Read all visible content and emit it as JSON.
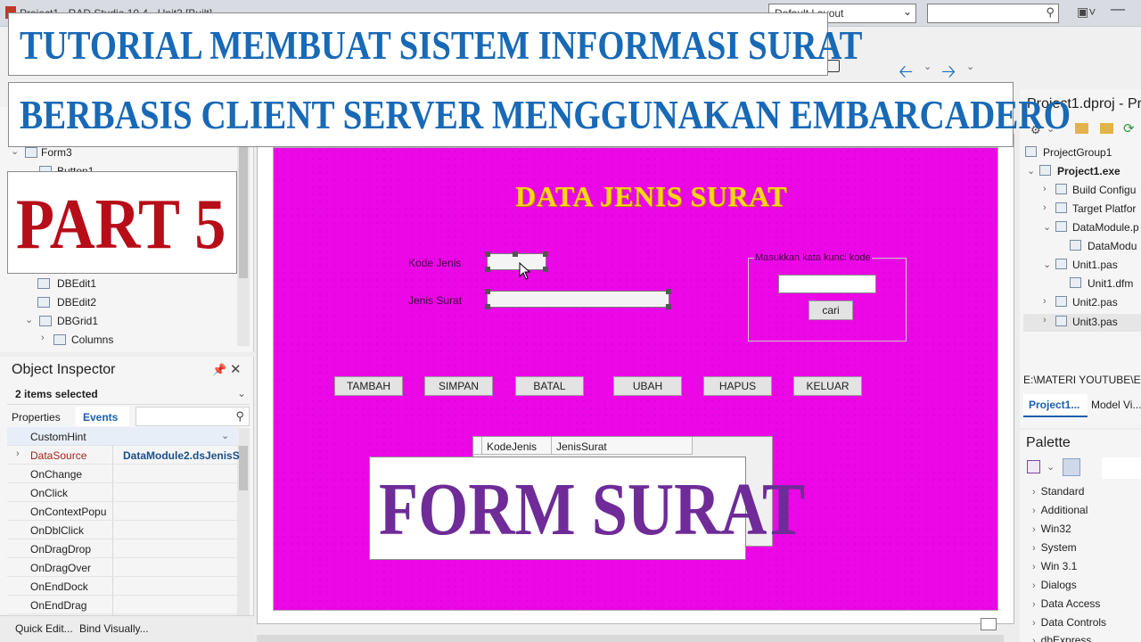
{
  "window": {
    "title": "Project1 - RAD Studio 10.4 - Unit3 [Built]",
    "layout_combo": "Default Layout",
    "search_placeholder": ""
  },
  "banners": {
    "title_line1": "TUTORIAL MEMBUAT SISTEM INFORMASI SURAT",
    "title_line2": "BERBASIS CLIENT SERVER MENGGUNAKAN EMBARCADERO",
    "part": "PART 5",
    "form_title": "FORM SURAT"
  },
  "structure": {
    "items": [
      {
        "label": "Form3",
        "icon": "form-icon"
      },
      {
        "label": "Button1",
        "icon": "button-icon"
      },
      {
        "label": "DBEdit1",
        "icon": "dbedit-icon"
      },
      {
        "label": "DBEdit2",
        "icon": "dbedit-icon"
      },
      {
        "label": "DBGrid1",
        "icon": "dbgrid-icon"
      },
      {
        "label": "Columns",
        "icon": "columns-icon"
      }
    ]
  },
  "object_inspector": {
    "title": "Object Inspector",
    "selection": "2 items selected",
    "tab_properties": "Properties",
    "tab_events": "Events",
    "rows": [
      {
        "name": "CustomHint",
        "value": ""
      },
      {
        "name": "DataSource",
        "value": "DataModule2.dsJenisS"
      },
      {
        "name": "OnChange",
        "value": ""
      },
      {
        "name": "OnClick",
        "value": ""
      },
      {
        "name": "OnContextPopu",
        "value": ""
      },
      {
        "name": "OnDblClick",
        "value": ""
      },
      {
        "name": "OnDragDrop",
        "value": ""
      },
      {
        "name": "OnDragOver",
        "value": ""
      },
      {
        "name": "OnEndDock",
        "value": ""
      },
      {
        "name": "OnEndDrag",
        "value": ""
      }
    ],
    "quick_edit": "Quick Edit...",
    "bind_visually": "Bind Visually..."
  },
  "form": {
    "heading": "DATA JENIS SURAT",
    "label_kode": "Kode Jenis",
    "label_jenis": "Jenis Surat",
    "groupbox_caption": "Masukkan kata kunci kode",
    "search_button": "cari",
    "buttons": [
      "TAMBAH",
      "SIMPAN",
      "BATAL",
      "UBAH",
      "HAPUS",
      "KELUAR"
    ],
    "grid_columns": [
      "KodeJenis",
      "JenisSurat"
    ],
    "background_color": "#ec07e7"
  },
  "project": {
    "title": "Project1.dproj - Pr",
    "items": [
      {
        "label": "ProjectGroup1",
        "bold": false
      },
      {
        "label": "Project1.exe",
        "bold": true
      },
      {
        "label": "Build Configu",
        "bold": false
      },
      {
        "label": "Target Platfor",
        "bold": false
      },
      {
        "label": "DataModule.p",
        "bold": false
      },
      {
        "label": "DataModu",
        "bold": false
      },
      {
        "label": "Unit1.pas",
        "bold": false
      },
      {
        "label": "Unit1.dfm",
        "bold": false
      },
      {
        "label": "Unit2.pas",
        "bold": false
      },
      {
        "label": "Unit3.pas",
        "bold": false
      }
    ],
    "path": "E:\\MATERI YOUTUBE\\EM",
    "tab_project": "Project1...",
    "tab_model": "Model Vi..."
  },
  "palette": {
    "title": "Palette",
    "categories": [
      "Standard",
      "Additional",
      "Win32",
      "System",
      "Win 3.1",
      "Dialogs",
      "Data Access",
      "Data Controls",
      "dbExpress"
    ]
  }
}
